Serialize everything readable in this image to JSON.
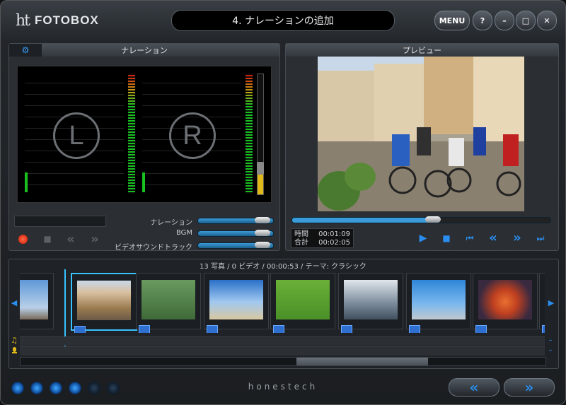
{
  "app": {
    "logo_mark": "ht",
    "logo_text": "FOTOBOX",
    "title": "4. ナレーションの追加",
    "brand": "honestech"
  },
  "window_buttons": {
    "menu": "MENU",
    "help": "?",
    "minimize": "–",
    "maximize": "□",
    "close": "✕"
  },
  "narration_panel": {
    "title": "ナレーション",
    "gear_glyph": "⚙",
    "left_label": "L",
    "right_label": "R",
    "sliders": [
      {
        "label": "ナレーション",
        "value": 0.85
      },
      {
        "label": "BGM",
        "value": 0.85
      },
      {
        "label": "ビデオサウンドトラック",
        "value": 0.85
      }
    ],
    "controls": {
      "record": "●",
      "stop": "■",
      "rewind": "«",
      "forward": "»"
    }
  },
  "preview_panel": {
    "title": "プレビュー",
    "seek": 0.55,
    "time_label": "時間",
    "time_value": "00:01:09",
    "total_label": "合計",
    "total_value": "00:02:05",
    "controls": {
      "play": "▶",
      "stop": "■",
      "first": "⏮",
      "prev": "«",
      "next": "»",
      "last": "⏭"
    }
  },
  "timeline": {
    "info": "13 写真 / 0 ビデオ / 00:00:53 / テーマ: クラシック",
    "left_arrow": "◀",
    "right_arrow": "▶",
    "thumbnails": [
      {
        "name": "flowers-sky",
        "color": "#7aa8d8"
      },
      {
        "name": "cyclists-street",
        "color": "#9a7a50"
      },
      {
        "name": "couple-bench",
        "color": "#5f8a50"
      },
      {
        "name": "beach-clouds",
        "color": "#6ea0d8"
      },
      {
        "name": "lambs-grass",
        "color": "#5aa030"
      },
      {
        "name": "penguins-rocks",
        "color": "#8090a0"
      },
      {
        "name": "penguins-pool",
        "color": "#3f8cd0"
      },
      {
        "name": "clownfish-anemone",
        "color": "#d06040"
      }
    ]
  },
  "bottom": {
    "back": "«",
    "next": "»"
  },
  "colors": {
    "accent": "#36c3ff",
    "record": "#e02010",
    "blue_button": "#2a8ef0"
  }
}
